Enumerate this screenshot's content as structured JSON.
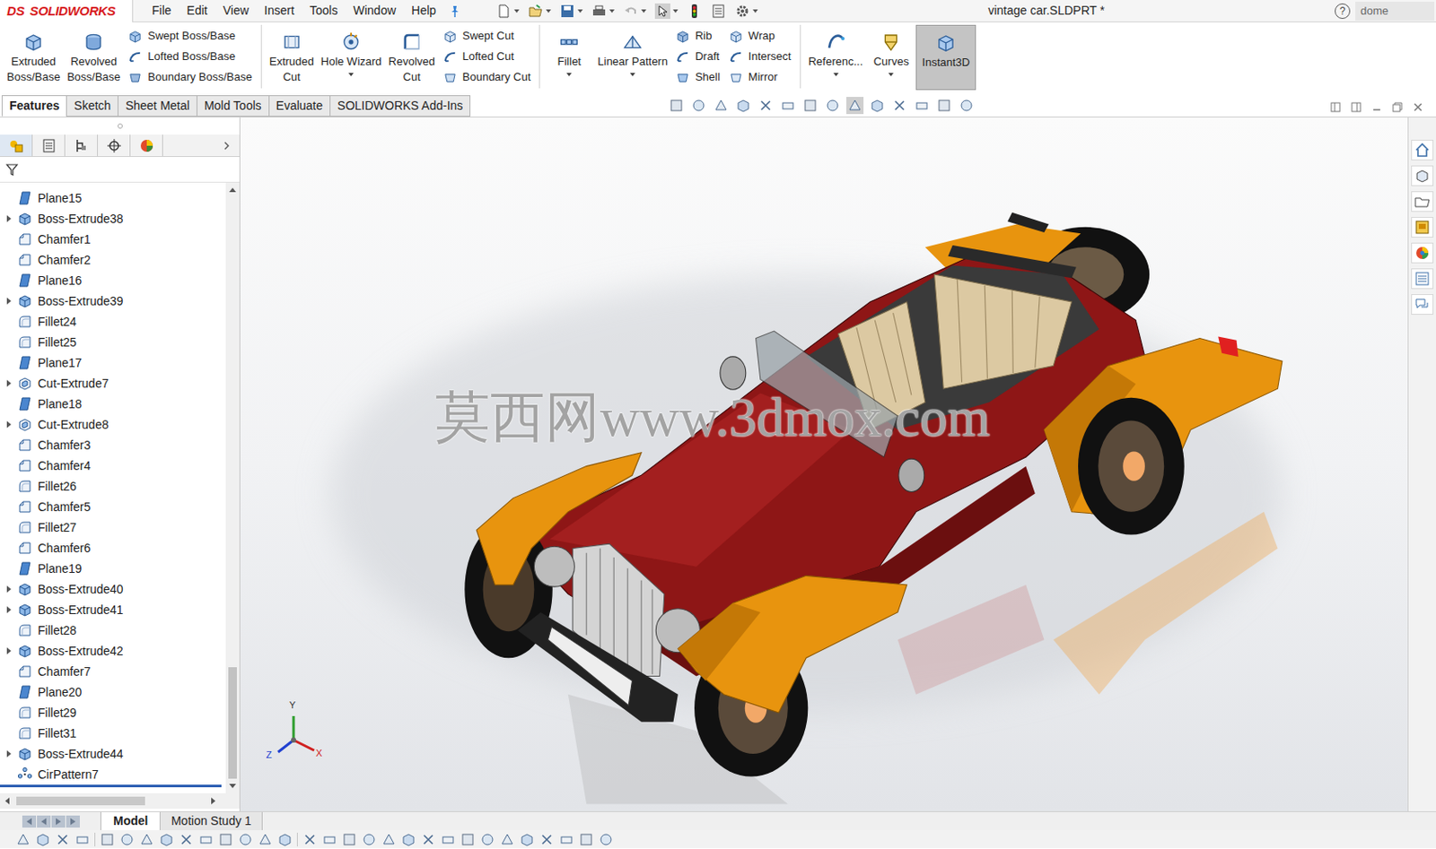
{
  "window": {
    "title": "vintage car.SLDPRT *"
  },
  "logo": {
    "mark": "DS",
    "name": "SOLIDWORKS"
  },
  "menu": [
    "File",
    "Edit",
    "View",
    "Insert",
    "Tools",
    "Window",
    "Help"
  ],
  "help": {
    "icon": "?"
  },
  "search": {
    "value": "dome"
  },
  "ribbon": {
    "items": [
      {
        "kind": "large",
        "lines": [
          "Extruded",
          "Boss/Base"
        ],
        "dropdown": false,
        "selected": false
      },
      {
        "kind": "large",
        "lines": [
          "Revolved",
          "Boss/Base"
        ],
        "dropdown": false,
        "selected": false
      },
      {
        "kind": "stack",
        "entries": [
          "Swept Boss/Base",
          "Lofted Boss/Base",
          "Boundary Boss/Base"
        ]
      },
      {
        "kind": "separator"
      },
      {
        "kind": "large",
        "lines": [
          "Extruded",
          "Cut"
        ],
        "dropdown": false,
        "selected": false
      },
      {
        "kind": "large",
        "lines": [
          "Hole Wizard"
        ],
        "dropdown": true,
        "selected": false
      },
      {
        "kind": "large",
        "lines": [
          "Revolved",
          "Cut"
        ],
        "dropdown": false,
        "selected": false
      },
      {
        "kind": "stack",
        "entries": [
          "Swept Cut",
          "Lofted Cut",
          "Boundary Cut"
        ]
      },
      {
        "kind": "separator"
      },
      {
        "kind": "large",
        "lines": [
          "Fillet"
        ],
        "dropdown": true,
        "selected": false
      },
      {
        "kind": "large",
        "lines": [
          "Linear Pattern"
        ],
        "dropdown": true,
        "selected": false
      },
      {
        "kind": "stack",
        "entries": [
          "Rib",
          "Draft",
          "Shell"
        ]
      },
      {
        "kind": "stack",
        "entries": [
          "Wrap",
          "Intersect",
          "Mirror"
        ]
      },
      {
        "kind": "separator"
      },
      {
        "kind": "large",
        "lines": [
          "Referenc..."
        ],
        "dropdown": true,
        "selected": false
      },
      {
        "kind": "large",
        "lines": [
          "Curves"
        ],
        "dropdown": true,
        "selected": false
      },
      {
        "kind": "large",
        "lines": [
          "Instant3D"
        ],
        "dropdown": false,
        "selected": true
      }
    ]
  },
  "tabs": [
    {
      "label": "Features",
      "selected": true
    },
    {
      "label": "Sketch",
      "selected": false
    },
    {
      "label": "Sheet Metal",
      "selected": false
    },
    {
      "label": "Mold Tools",
      "selected": false
    },
    {
      "label": "Evaluate",
      "selected": false
    },
    {
      "label": "SOLIDWORKS Add-Ins",
      "selected": false
    }
  ],
  "panel_tabs": [
    {
      "selected": true
    },
    {
      "selected": false
    },
    {
      "selected": false
    },
    {
      "selected": false
    },
    {
      "selected": false
    }
  ],
  "feature_tree": {
    "items": [
      {
        "label": "Plane15",
        "kind": "plane",
        "expandable": false
      },
      {
        "label": "Boss-Extrude38",
        "kind": "boss",
        "expandable": true
      },
      {
        "label": "Chamfer1",
        "kind": "chamfer",
        "expandable": false
      },
      {
        "label": "Chamfer2",
        "kind": "chamfer",
        "expandable": false
      },
      {
        "label": "Plane16",
        "kind": "plane",
        "expandable": false
      },
      {
        "label": "Boss-Extrude39",
        "kind": "boss",
        "expandable": true
      },
      {
        "label": "Fillet24",
        "kind": "fillet",
        "expandable": false
      },
      {
        "label": "Fillet25",
        "kind": "fillet",
        "expandable": false
      },
      {
        "label": "Plane17",
        "kind": "plane",
        "expandable": false
      },
      {
        "label": "Cut-Extrude7",
        "kind": "cut",
        "expandable": true
      },
      {
        "label": "Plane18",
        "kind": "plane",
        "expandable": false
      },
      {
        "label": "Cut-Extrude8",
        "kind": "cut",
        "expandable": true
      },
      {
        "label": "Chamfer3",
        "kind": "chamfer",
        "expandable": false
      },
      {
        "label": "Chamfer4",
        "kind": "chamfer",
        "expandable": false
      },
      {
        "label": "Fillet26",
        "kind": "fillet",
        "expandable": false
      },
      {
        "label": "Chamfer5",
        "kind": "chamfer",
        "expandable": false
      },
      {
        "label": "Fillet27",
        "kind": "fillet",
        "expandable": false
      },
      {
        "label": "Chamfer6",
        "kind": "chamfer",
        "expandable": false
      },
      {
        "label": "Plane19",
        "kind": "plane",
        "expandable": false
      },
      {
        "label": "Boss-Extrude40",
        "kind": "boss",
        "expandable": true
      },
      {
        "label": "Boss-Extrude41",
        "kind": "boss",
        "expandable": true
      },
      {
        "label": "Fillet28",
        "kind": "fillet",
        "expandable": false
      },
      {
        "label": "Boss-Extrude42",
        "kind": "boss",
        "expandable": true
      },
      {
        "label": "Chamfer7",
        "kind": "chamfer",
        "expandable": false
      },
      {
        "label": "Plane20",
        "kind": "plane",
        "expandable": false
      },
      {
        "label": "Fillet29",
        "kind": "fillet",
        "expandable": false
      },
      {
        "label": "Fillet31",
        "kind": "fillet",
        "expandable": false
      },
      {
        "label": "Boss-Extrude44",
        "kind": "boss",
        "expandable": true
      },
      {
        "label": "CirPattern7",
        "kind": "pattern",
        "expandable": false
      }
    ]
  },
  "viewport": {
    "watermark": "莫西网www.3dmox.com",
    "axes": [
      {
        "label": "Y"
      },
      {
        "label": "X"
      },
      {
        "label": "Z"
      }
    ]
  },
  "bottom_tabs": [
    {
      "label": "Model",
      "selected": true
    },
    {
      "label": "Motion Study 1",
      "selected": false
    }
  ]
}
